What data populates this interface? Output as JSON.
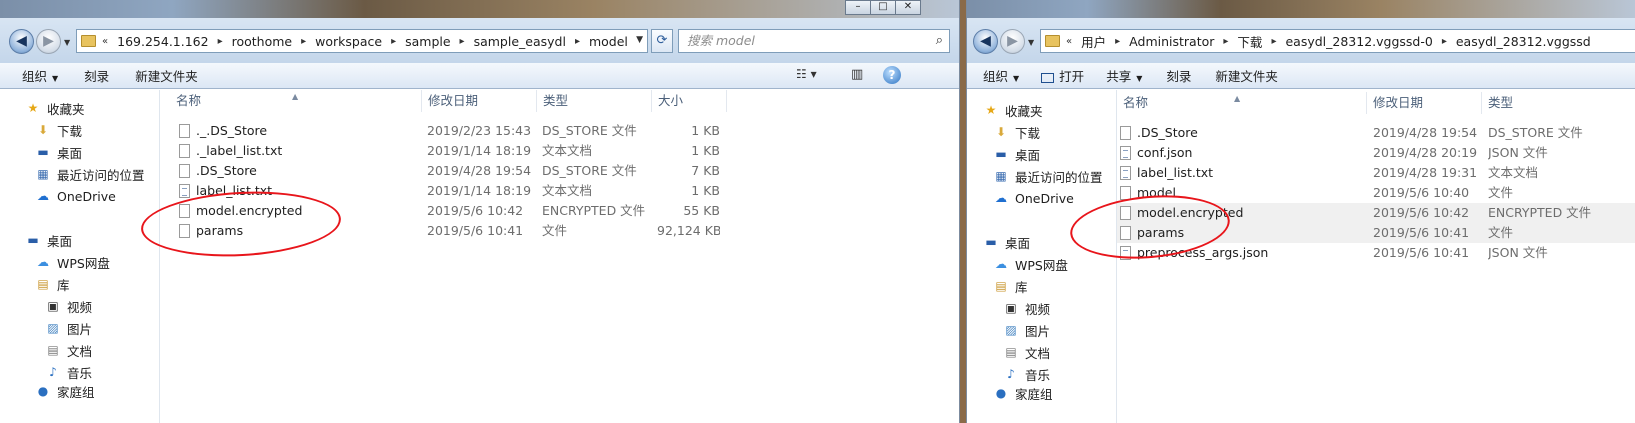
{
  "left": {
    "address": [
      "169.254.1.162",
      "roothome",
      "workspace",
      "sample",
      "sample_easydl",
      "model"
    ],
    "search_placeholder": "搜索 model",
    "toolbar": [
      "组织",
      "刻录",
      "新建文件夹"
    ],
    "nav": [
      "收藏夹",
      "下载",
      "桌面",
      "最近访问的位置",
      "OneDrive",
      "桌面",
      "WPS网盘",
      "库",
      "视频",
      "图片",
      "文档",
      "音乐",
      "家庭组"
    ],
    "columns": [
      "名称",
      "修改日期",
      "类型",
      "大小"
    ],
    "files": [
      {
        "name": "._.DS_Store",
        "date": "2019/2/23 15:43",
        "type": "DS_STORE 文件",
        "size": "1 KB"
      },
      {
        "name": "._label_list.txt",
        "date": "2019/1/14 18:19",
        "type": "文本文档",
        "size": "1 KB"
      },
      {
        "name": ".DS_Store",
        "date": "2019/4/28 19:54",
        "type": "DS_STORE 文件",
        "size": "7 KB"
      },
      {
        "name": "label_list.txt",
        "date": "2019/1/14 18:19",
        "type": "文本文档",
        "size": "1 KB"
      },
      {
        "name": "model.encrypted",
        "date": "2019/5/6 10:42",
        "type": "ENCRYPTED 文件",
        "size": "55 KB"
      },
      {
        "name": "params",
        "date": "2019/5/6 10:41",
        "type": "文件",
        "size": "92,124 KB"
      }
    ]
  },
  "right": {
    "address": [
      "用户",
      "Administrator",
      "下载",
      "easydl_28312.vggssd-0",
      "easydl_28312.vggssd"
    ],
    "toolbar": [
      "组织",
      "打开",
      "共享",
      "刻录",
      "新建文件夹"
    ],
    "nav": [
      "收藏夹",
      "下载",
      "桌面",
      "最近访问的位置",
      "OneDrive",
      "桌面",
      "WPS网盘",
      "库",
      "视频",
      "图片",
      "文档",
      "音乐",
      "家庭组"
    ],
    "columns": [
      "名称",
      "修改日期",
      "类型"
    ],
    "files": [
      {
        "name": ".DS_Store",
        "date": "2019/4/28 19:54",
        "type": "DS_STORE 文件"
      },
      {
        "name": "conf.json",
        "date": "2019/4/28 20:19",
        "type": "JSON 文件"
      },
      {
        "name": "label_list.txt",
        "date": "2019/4/28 19:31",
        "type": "文本文档"
      },
      {
        "name": "model",
        "date": "2019/5/6 10:40",
        "type": "文件"
      },
      {
        "name": "model.encrypted",
        "date": "2019/5/6 10:42",
        "type": "ENCRYPTED 文件"
      },
      {
        "name": "params",
        "date": "2019/5/6 10:41",
        "type": "文件"
      },
      {
        "name": "preprocess_args.json",
        "date": "2019/5/6 10:41",
        "type": "JSON 文件"
      }
    ]
  },
  "window_buttons": [
    "–",
    "□",
    "✕"
  ],
  "colors": {
    "annotation": "#e8151b",
    "toolbar_bg": "#dce7f5",
    "header_text": "#4c607a"
  }
}
